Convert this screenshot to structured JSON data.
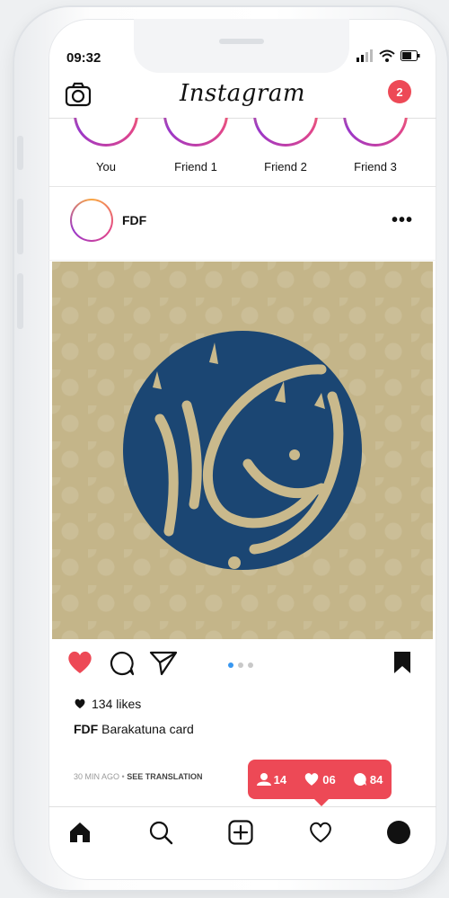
{
  "status_bar": {
    "time": "09:32"
  },
  "header": {
    "title": "Instagram",
    "notification_count": "2"
  },
  "stories": [
    {
      "label": "You"
    },
    {
      "label": "Friend 1"
    },
    {
      "label": "Friend 2"
    },
    {
      "label": "Friend 3"
    }
  ],
  "post": {
    "username": "FDF",
    "more_label": "•••",
    "likes": "134 likes",
    "caption_user": "FDF",
    "caption_text": "Barakatuna card",
    "time_ago": "30 MIN AGO",
    "separator": "•",
    "see_translation": "SEE TRANSLATION",
    "carousel_active_index": 0,
    "carousel_count": 3
  },
  "activity": {
    "followers": "14",
    "likes": "06",
    "comments": "84"
  },
  "colors": {
    "accent_red": "#ed4956",
    "image_gold": "#c4b589",
    "emblem_blue": "#1b4673",
    "carousel_active": "#3897f0"
  },
  "icons": {
    "camera": "camera-icon",
    "heart": "heart-icon",
    "comment": "comment-icon",
    "share": "send-icon",
    "bookmark": "bookmark-icon",
    "home": "home-icon",
    "search": "search-icon",
    "add": "add-post-icon",
    "activity": "heart-outline-icon",
    "profile": "profile-icon"
  }
}
